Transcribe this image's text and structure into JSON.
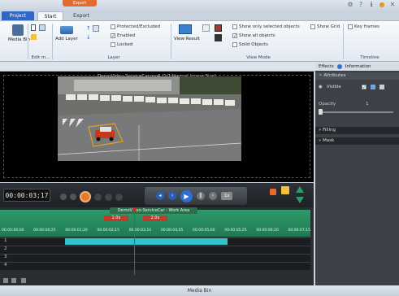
{
  "topbar": {
    "context_tab": "Export"
  },
  "tabs": [
    {
      "label": "Project"
    },
    {
      "label": "Start"
    },
    {
      "label": "Export Media"
    }
  ],
  "ribbon": {
    "media_bin": "Media Bin",
    "edit_group": "Edit m...",
    "add_layer": "Add Layer",
    "layer_group": "Layer",
    "layer_options": [
      "Protected/Excluded",
      "Enabled",
      "Locked"
    ],
    "layer_checked": [
      false,
      true,
      false
    ],
    "view_result": "View Result",
    "view_options": [
      "Show only selected objects",
      "Show all objects",
      "Solid Objects"
    ],
    "view_checked": [
      false,
      true,
      false
    ],
    "show_grid": "Show Grid",
    "key_frames": "Key frames",
    "view_mode_group": "View Mode",
    "timeline_group": "Timeline"
  },
  "viewer": {
    "title": "DemoVideo-ServiceCar.mp4   (1/1  Normal Image Size)"
  },
  "right_panel": {
    "tabs": [
      "Effects",
      "Information"
    ],
    "attributes": "Attributes",
    "visible": "Visible",
    "opacity": "Opacity",
    "opacity_value": "1",
    "filling": "Filling",
    "mask": "Mask"
  },
  "transport": {
    "timecode": "00:00:03;17",
    "speed": "1x"
  },
  "timeline": {
    "work_area": "DemoVideo-ServiceCar - Work Area",
    "marker1": "1.0x",
    "marker2": "2.0x",
    "ticks": [
      "00:00:00;00",
      "00:00:00;25",
      "00:00:01;20",
      "00:00:02;15",
      "00:00:03;10",
      "00:00:04;05",
      "00:00:05;00",
      "00:00:05;25",
      "00:00:06;20",
      "00:00:07;15"
    ],
    "tracks": [
      "1",
      "2",
      "3",
      "4"
    ]
  },
  "status": {
    "media_bin": "Media Bin"
  },
  "colors": {
    "accent": "#2f66c8",
    "export": "#e36b2e",
    "timeline": "#2f9a6b",
    "clip": "#2fc2c8",
    "playhead": "#e0281f"
  }
}
